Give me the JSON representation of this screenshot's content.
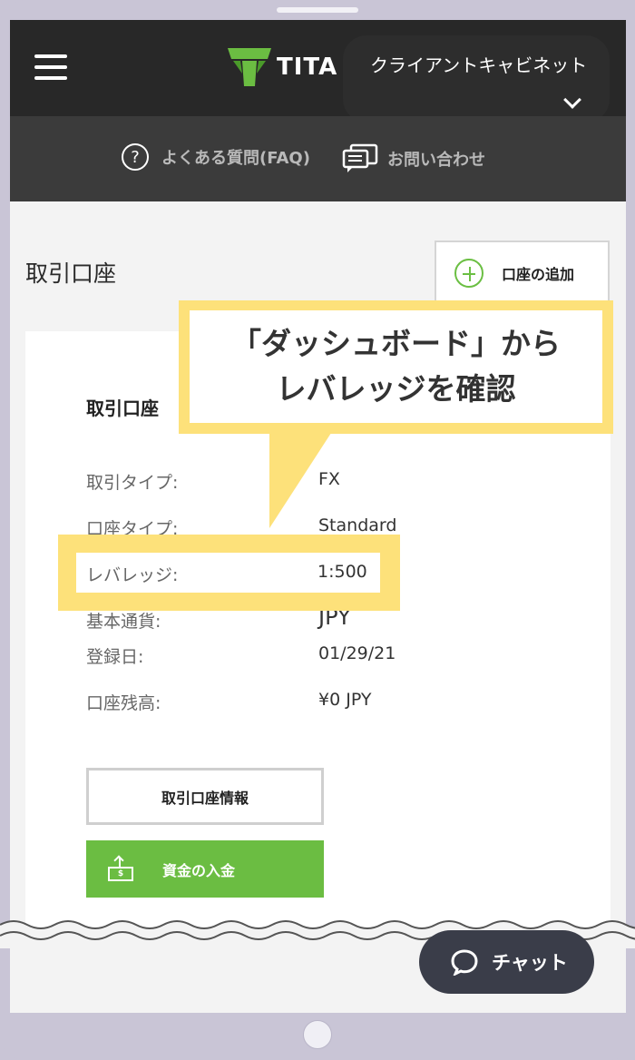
{
  "header": {
    "logo_text": "TITA",
    "cabinet_label": "クライアントキャビネット",
    "faq_icon": "?",
    "faq_label": "よくある質問(FAQ)",
    "contact_label": "お問い合わせ"
  },
  "main": {
    "page_title": "取引口座",
    "add_account_label": "口座の追加",
    "card_title": "取引口座",
    "rows": [
      {
        "label": "取引タイプ:",
        "value": "FX"
      },
      {
        "label": "口座タイプ:",
        "value": "Standard"
      },
      {
        "label": "レバレッジ:",
        "value": "1:500"
      },
      {
        "label": "基本通貨:",
        "value": "JPY"
      },
      {
        "label": "登録日:",
        "value": "01/29/21"
      },
      {
        "label": "口座残高:",
        "value": "¥0 JPY"
      }
    ],
    "info_button": "取引口座情報",
    "deposit_button": "資金の入金",
    "deposit_icon_symbol": "$"
  },
  "callout": {
    "line1": "「ダッシュボード」から",
    "line2": "レバレッジを確認"
  },
  "chat": {
    "label": "チャット"
  },
  "colors": {
    "accent_green": "#6bbd42",
    "highlight_yellow": "#fde17a",
    "header_dark": "#282828"
  }
}
